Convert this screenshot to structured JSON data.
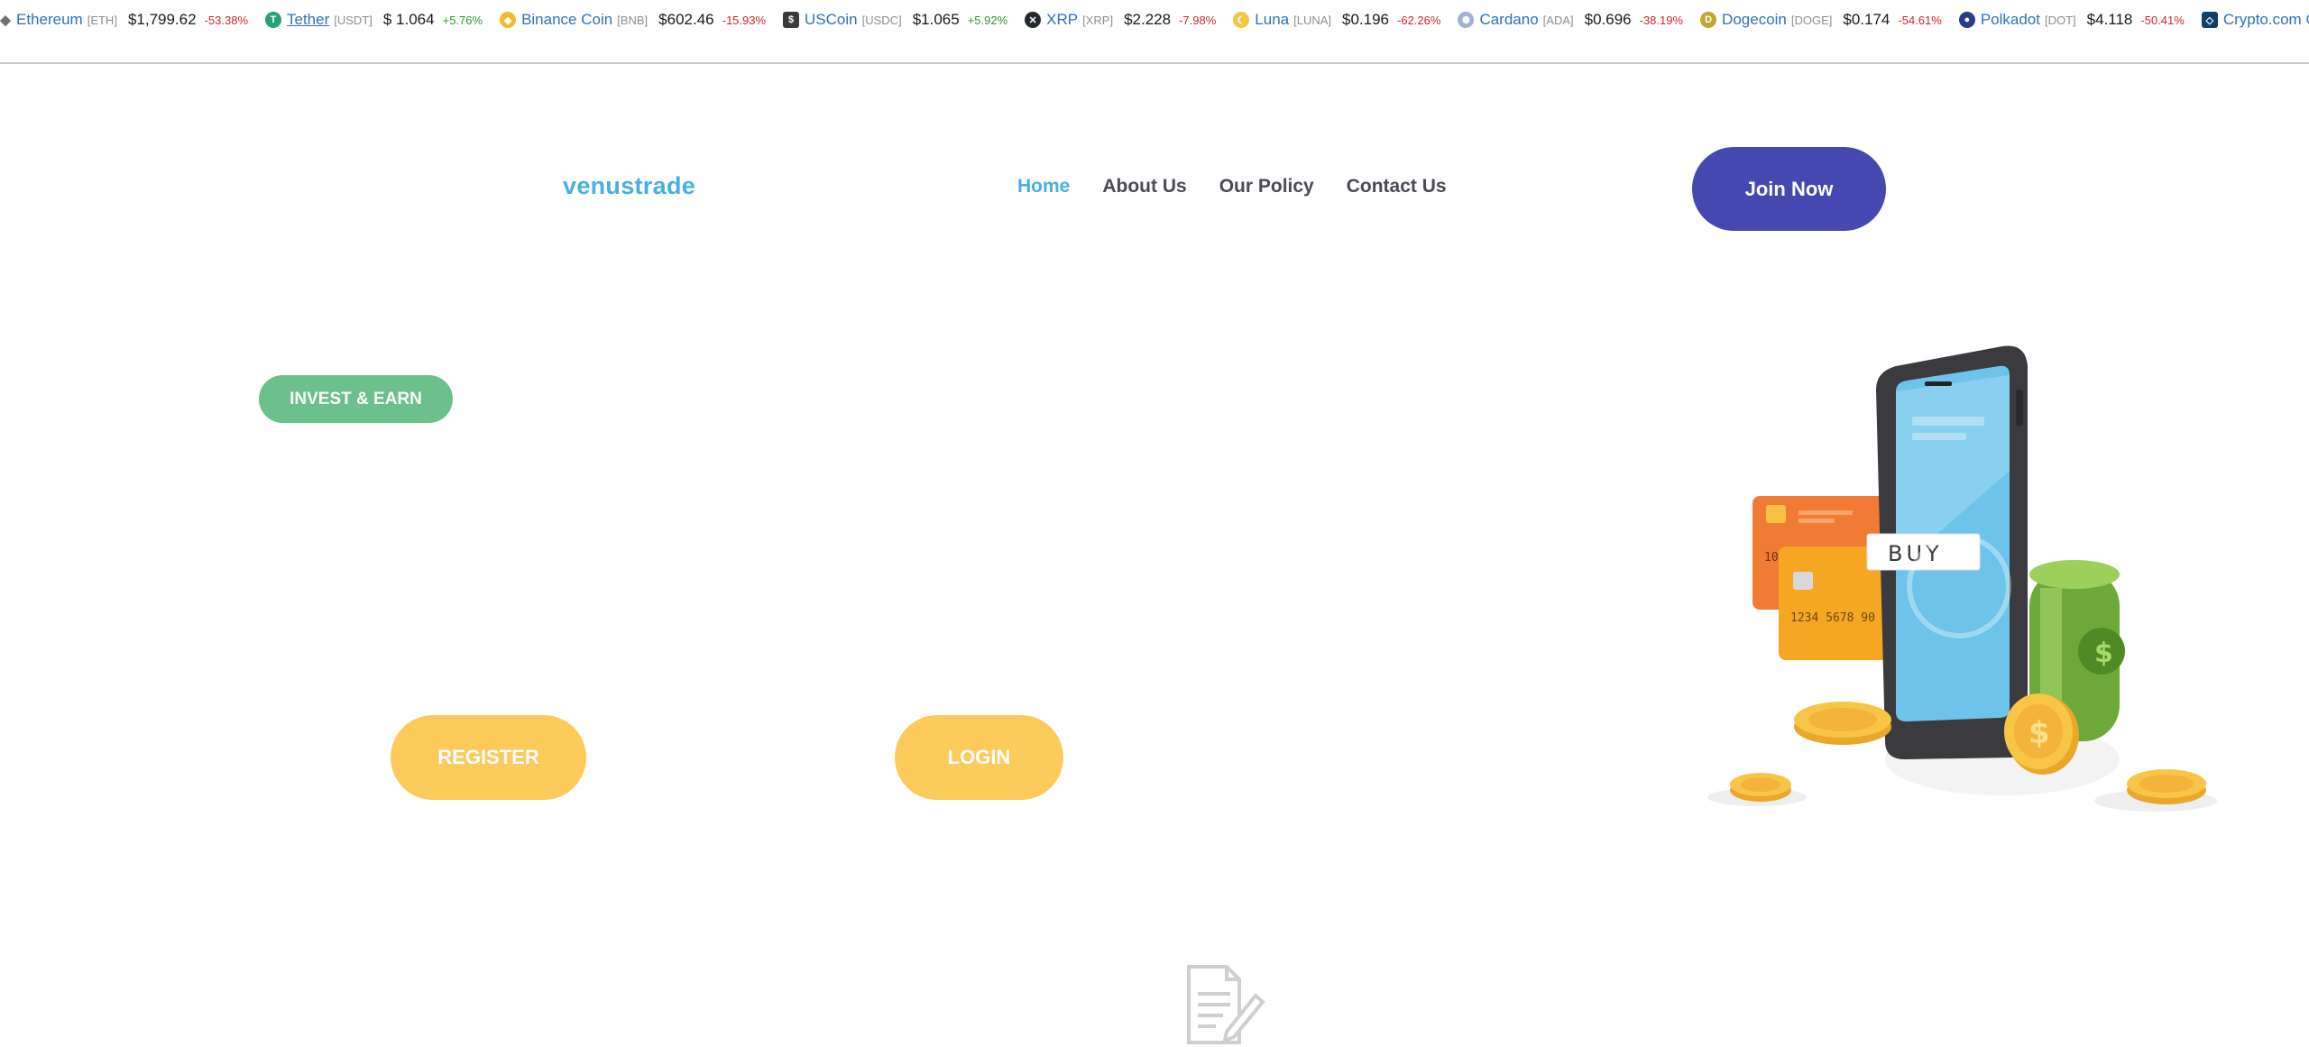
{
  "ticker": [
    {
      "icon": "ethereum-icon",
      "name": "Ethereum",
      "symbol": "[ETH]",
      "price": "$1,799.62",
      "change": "-53.38%",
      "direction": "neg",
      "color": "#6f6f6f"
    },
    {
      "icon": "tether-icon",
      "name": "Tether",
      "symbol": "[USDT]",
      "price": "$ 1.064",
      "change": "+5.76%",
      "direction": "pos",
      "color": "#26a17b"
    },
    {
      "icon": "binance-coin-icon",
      "name": "Binance Coin",
      "symbol": "[BNB]",
      "price": "$602.46",
      "change": "-15.93%",
      "direction": "neg",
      "color": "#f3ba2f"
    },
    {
      "icon": "uscoin-icon",
      "name": "USCoin",
      "symbol": "[USDC]",
      "price": "$1.065",
      "change": "+5.92%",
      "direction": "pos",
      "color": "#3a3a3a"
    },
    {
      "icon": "xrp-icon",
      "name": "XRP",
      "symbol": "[XRP]",
      "price": "$2.228",
      "change": "-7.98%",
      "direction": "neg",
      "color": "#23292f"
    },
    {
      "icon": "luna-icon",
      "name": "Luna",
      "symbol": "[LUNA]",
      "price": "$0.196",
      "change": "-62.26%",
      "direction": "neg",
      "color": "#f5c543"
    },
    {
      "icon": "cardano-icon",
      "name": "Cardano",
      "symbol": "[ADA]",
      "price": "$0.696",
      "change": "-38.19%",
      "direction": "neg",
      "color": "#9fb3d6"
    },
    {
      "icon": "dogecoin-icon",
      "name": "Dogecoin",
      "symbol": "[DOGE]",
      "price": "$0.174",
      "change": "-54.61%",
      "direction": "neg",
      "color": "#c2a633"
    },
    {
      "icon": "polkadot-icon",
      "name": "Polkadot",
      "symbol": "[DOT]",
      "price": "$4.118",
      "change": "-50.41%",
      "direction": "neg",
      "color": "#2b3c8a"
    },
    {
      "icon": "crypto-com-icon",
      "name": "Crypto.com Ch",
      "symbol": "",
      "price": "",
      "change": "",
      "direction": "neg",
      "color": "#103f68"
    }
  ],
  "header": {
    "logo": "venustrade",
    "nav": [
      {
        "label": "Home",
        "active": true
      },
      {
        "label": "About Us",
        "active": false
      },
      {
        "label": "Our Policy",
        "active": false
      },
      {
        "label": "Contact Us",
        "active": false
      }
    ],
    "join_label": "Join Now"
  },
  "hero": {
    "badge": "INVEST & EARN",
    "register_label": "REGISTER",
    "login_label": "LOGIN",
    "illustration": {
      "buy_label": "BUY",
      "card_number_back": "1084 5612 98",
      "card_number_front": "1234 5678 90"
    }
  },
  "colors": {
    "accent_blue": "#46b0e0",
    "join_button": "#4448b0",
    "badge_green": "#6cc08c",
    "pill_yellow": "#fdca5c",
    "nav_text": "#4a4b53"
  }
}
